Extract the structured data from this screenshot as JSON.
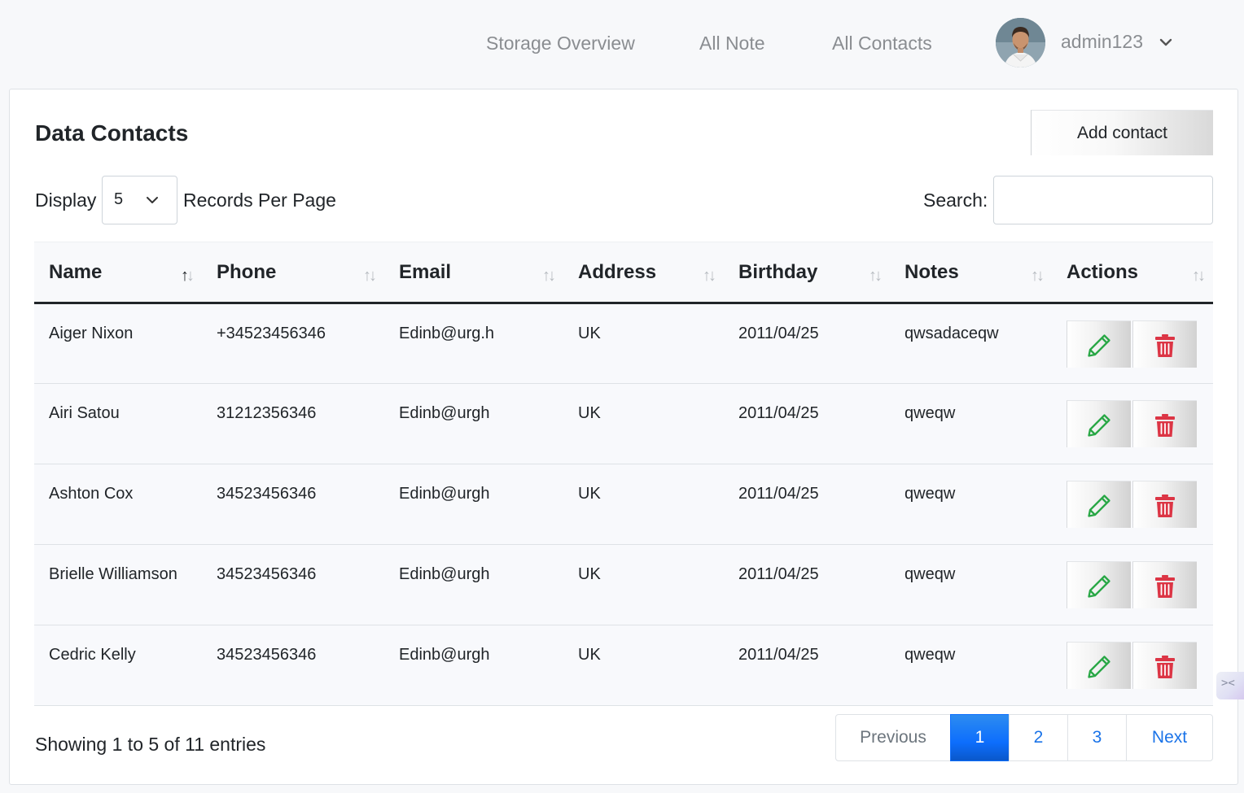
{
  "nav": {
    "links": [
      "Storage Overview",
      "All Note",
      "All Contacts"
    ],
    "username": "admin123"
  },
  "card": {
    "title": "Data Contacts",
    "add_button": "Add contact",
    "display_label": "Display",
    "page_size": "5",
    "records_label": "Records Per Page",
    "search_label": "Search:",
    "search_value": ""
  },
  "table": {
    "columns": [
      "Name",
      "Phone",
      "Email",
      "Address",
      "Birthday",
      "Notes",
      "Actions"
    ],
    "sorted_column": "Name",
    "rows": [
      {
        "name": "Aiger Nixon",
        "phone": "+34523456346",
        "email": "Edinb@urg.h",
        "address": "UK",
        "birthday": "2011/04/25",
        "notes": "qwsadaceqw"
      },
      {
        "name": "Airi Satou",
        "phone": "31212356346",
        "email": "Edinb@urgh",
        "address": "UK",
        "birthday": "2011/04/25",
        "notes": "qweqw"
      },
      {
        "name": "Ashton Cox",
        "phone": "34523456346",
        "email": "Edinb@urgh",
        "address": "UK",
        "birthday": "2011/04/25",
        "notes": "qweqw"
      },
      {
        "name": "Brielle Williamson",
        "phone": "34523456346",
        "email": "Edinb@urgh",
        "address": "UK",
        "birthday": "2011/04/25",
        "notes": "qweqw"
      },
      {
        "name": "Cedric Kelly",
        "phone": "34523456346",
        "email": "Edinb@urgh",
        "address": "UK",
        "birthday": "2011/04/25",
        "notes": "qweqw"
      }
    ]
  },
  "footer": {
    "info": "Showing 1 to 5 of 11 entries",
    "previous": "Previous",
    "pages": [
      "1",
      "2",
      "3"
    ],
    "active_page": "1",
    "next": "Next"
  },
  "colors": {
    "edit_icon": "#28a745",
    "delete_icon": "#dc3545",
    "accent": "#0d6efd"
  },
  "icons": {
    "user_menu": "chevron-down-icon",
    "edit": "pencil-icon",
    "delete": "trash-icon",
    "sort": "sort-arrows-icon"
  }
}
